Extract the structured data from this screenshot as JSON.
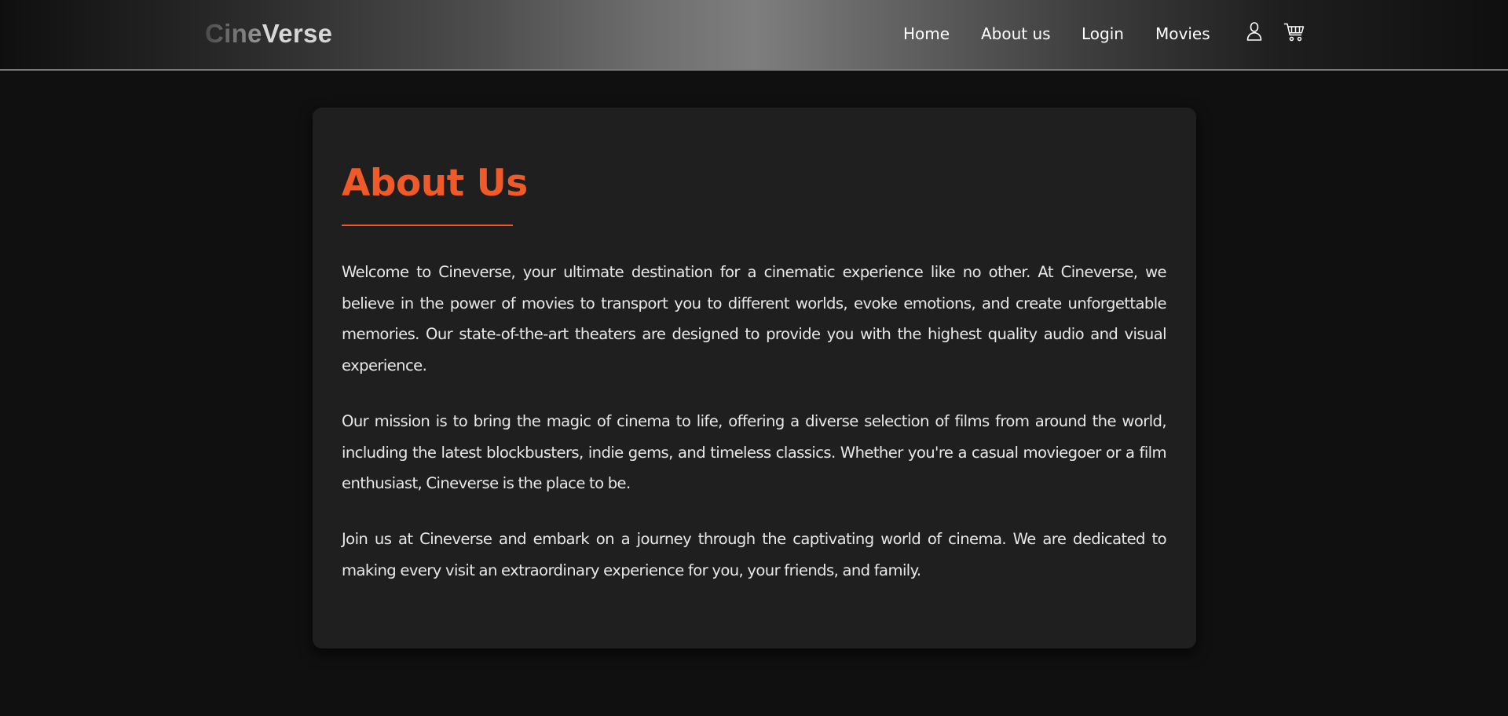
{
  "brand": {
    "logo_part1": "Cine",
    "logo_part2": "Verse",
    "accent_color": "#f05a28"
  },
  "nav": {
    "links": [
      {
        "label": "Home"
      },
      {
        "label": "About us"
      },
      {
        "label": "Login"
      },
      {
        "label": "Movies"
      }
    ],
    "icons": [
      "user-icon",
      "cart-icon"
    ]
  },
  "about": {
    "title": "About Us",
    "paragraphs": [
      "Welcome to Cineverse, your ultimate destination for a cinematic experience like no other. At Cineverse, we believe in the power of movies to transport you to different worlds, evoke emotions, and create unforgettable memories. Our state-of-the-art theaters are designed to provide you with the highest quality audio and visual experience.",
      "Our mission is to bring the magic of cinema to life, offering a diverse selection of films from around the world, including the latest blockbusters, indie gems, and timeless classics. Whether you're a casual moviegoer or a film enthusiast, Cineverse is the place to be.",
      "Join us at Cineverse and embark on a journey through the captivating world of cinema. We are dedicated to making every visit an extraordinary experience for you, your friends, and family."
    ]
  }
}
